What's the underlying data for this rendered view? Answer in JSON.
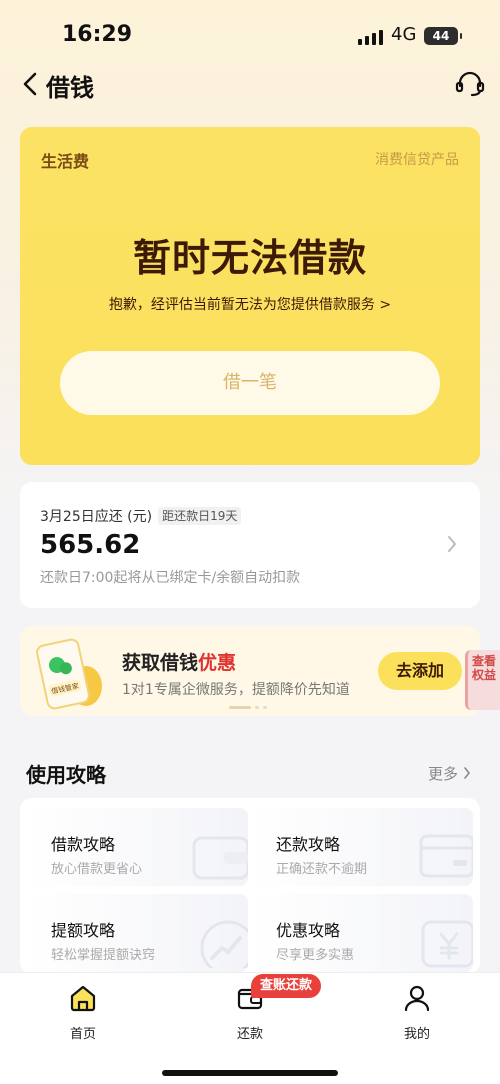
{
  "status_bar": {
    "time": "16:29",
    "network": "4G",
    "battery": "44"
  },
  "nav": {
    "back_icon": "chevron-left-icon",
    "title": "借钱",
    "service_icon": "headset-icon"
  },
  "loan_card": {
    "tag": "生活费",
    "tag_right": "消费信贷产品",
    "headline": "暂时无法借款",
    "reason": "抱歉，经评估当前暂无法为您提供借款服务 >",
    "button_label": "借一笔"
  },
  "repay_card": {
    "date_label": "3月25日应还 (元)",
    "countdown": "距还款日19天",
    "amount": "565.62",
    "note": "还款日7:00起将从已绑定卡/余额自动扣款"
  },
  "promo": {
    "phone_label": "借钱管家",
    "title_prefix": "获取借钱",
    "title_highlight": "优惠",
    "desc": "1对1专属企微服务，提额降价先知道",
    "button_label": "去添加",
    "side_tab": "查看权益"
  },
  "guides": {
    "title": "使用攻略",
    "more_label": "更多",
    "items": [
      {
        "title": "借款攻略",
        "subtitle": "放心借款更省心"
      },
      {
        "title": "还款攻略",
        "subtitle": "正确还款不逾期"
      },
      {
        "title": "提额攻略",
        "subtitle": "轻松掌握提额诀窍"
      },
      {
        "title": "优惠攻略",
        "subtitle": "尽享更多实惠"
      }
    ]
  },
  "tabbar": {
    "badge": "查账还款",
    "tabs": [
      {
        "label": "首页",
        "icon": "home-icon"
      },
      {
        "label": "还款",
        "icon": "wallet-icon"
      },
      {
        "label": "我的",
        "icon": "user-icon"
      }
    ]
  },
  "colors": {
    "accent_yellow": "#fbe05b",
    "highlight_red": "#e0322f",
    "badge_red": "#e8413c"
  }
}
